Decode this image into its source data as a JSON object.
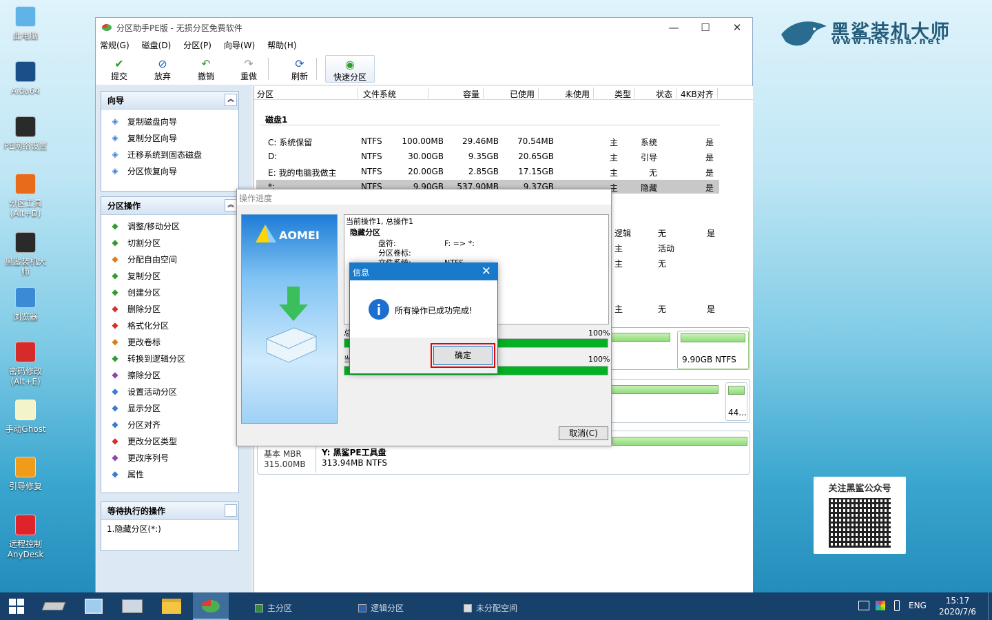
{
  "desktop": {
    "icons": [
      {
        "label": "此电脑",
        "name": "this-pc"
      },
      {
        "label": "Aida64",
        "name": "aida64"
      },
      {
        "label": "PE网络设置",
        "name": "pe-network"
      },
      {
        "label": "分区工具\n(Alt+D)",
        "name": "partition-tool"
      },
      {
        "label": "黑鲨装机大\n师",
        "name": "heisha-installer"
      },
      {
        "label": "浏览器",
        "name": "browser"
      },
      {
        "label": "密码修改\n(Alt+E)",
        "name": "password-change"
      },
      {
        "label": "手动Ghost",
        "name": "manual-ghost"
      },
      {
        "label": "引导修复",
        "name": "boot-repair"
      },
      {
        "label": "远程控制\nAnyDesk",
        "name": "anydesk"
      }
    ],
    "brand_name": "黑鲨装机大师",
    "brand_url": "www.heisha.net",
    "qr_title": "关注黑鲨公众号"
  },
  "window": {
    "title": "分区助手PE版 - 无损分区免费软件",
    "menu": [
      "常规(G)",
      "磁盘(D)",
      "分区(P)",
      "向导(W)",
      "帮助(H)"
    ],
    "toolbar": [
      {
        "label": "提交",
        "icon": "check-icon",
        "color": "#2e9d2e"
      },
      {
        "label": "放弃",
        "icon": "discard-icon",
        "color": "#1d5fbf"
      },
      {
        "label": "撤销",
        "icon": "undo-icon",
        "color": "#2e9d2e"
      },
      {
        "label": "重做",
        "icon": "redo-icon",
        "color": "#999999"
      },
      {
        "label": "刷新",
        "icon": "refresh-icon",
        "color": "#1d5fbf"
      },
      {
        "label": "快速分区",
        "icon": "quick-partition-icon",
        "color": "#2e9d2e"
      }
    ]
  },
  "wizard": {
    "title": "向导",
    "items": [
      "复制磁盘向导",
      "复制分区向导",
      "迁移系统到固态磁盘",
      "分区恢复向导"
    ]
  },
  "operations": {
    "title": "分区操作",
    "items": [
      "调整/移动分区",
      "切割分区",
      "分配自由空间",
      "复制分区",
      "创建分区",
      "删除分区",
      "格式化分区",
      "更改卷标",
      "转换到逻辑分区",
      "擦除分区",
      "设置活动分区",
      "显示分区",
      "分区对齐",
      "更改分区类型",
      "更改序列号",
      "属性"
    ]
  },
  "pending": {
    "title": "等待执行的操作",
    "items": [
      "1.隐藏分区(*:)"
    ]
  },
  "table": {
    "headers": [
      "分区",
      "文件系统",
      "容量",
      "已使用",
      "未使用",
      "类型",
      "状态",
      "4KB对齐"
    ],
    "disk_label": "磁盘1",
    "rows": [
      [
        "C: 系统保留",
        "NTFS",
        "100.00MB",
        "29.46MB",
        "70.54MB",
        "主",
        "系统",
        "是"
      ],
      [
        "D:",
        "NTFS",
        "30.00GB",
        "9.35GB",
        "20.65GB",
        "主",
        "引导",
        "是"
      ],
      [
        "E: 我的电脑我做主",
        "NTFS",
        "20.00GB",
        "2.85GB",
        "17.15GB",
        "主",
        "无",
        "是"
      ],
      [
        "*:",
        "NTFS",
        "9.90GB",
        "537.90MB",
        "9.37GB",
        "主",
        "隐藏",
        "是"
      ]
    ],
    "partial_rows": [
      [
        "逻辑",
        "无",
        "是"
      ],
      [
        "主",
        "活动",
        ""
      ],
      [
        "主",
        "无",
        ""
      ],
      [
        "主",
        "无",
        "是"
      ]
    ]
  },
  "disk_map": {
    "card1_label": "9.90GB NTFS",
    "card2_label": "44...",
    "basic": "基本 MBR",
    "basic_size": "315.00MB",
    "y_name": "Y: 黑鲨PE工具盘",
    "y_size": "313.94MB NTFS"
  },
  "legend": [
    "主分区",
    "逻辑分区",
    "未分配空间"
  ],
  "progress": {
    "title": "操作进度",
    "brand": "AOMEI",
    "log_title": "当前操作1, 总操作1",
    "log_item": "隐藏分区",
    "log_lines": [
      [
        "盘符:",
        "F: => *:"
      ],
      [
        "分区卷标:",
        ""
      ],
      [
        "文件系统:",
        "NTFS"
      ]
    ],
    "bar1_pct": "100%",
    "bar2_pct": "100%",
    "bar1_value": 1.0,
    "bar2_value": 1.0,
    "bar1_label": "总",
    "bar2_label": "当",
    "cancel": "取消(C)"
  },
  "info": {
    "title": "信息",
    "message": "所有操作已成功完成!",
    "ok": "确定"
  },
  "tray": {
    "lang": "ENG",
    "time": "15:17",
    "date": "2020/7/6"
  }
}
